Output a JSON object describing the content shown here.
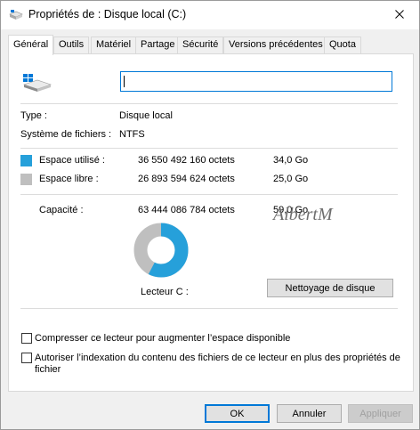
{
  "window": {
    "title": "Propriétés de : Disque local (C:)"
  },
  "tabs": [
    {
      "label": "Général"
    },
    {
      "label": "Outils"
    },
    {
      "label": "Matériel"
    },
    {
      "label": "Partage"
    },
    {
      "label": "Sécurité"
    },
    {
      "label": "Versions précédentes"
    },
    {
      "label": "Quota"
    }
  ],
  "volume_name": {
    "value": ""
  },
  "info": {
    "type_label": "Type :",
    "type_value": "Disque local",
    "fs_label": "Système de fichiers :",
    "fs_value": "NTFS"
  },
  "space": {
    "used_label": "Espace utilisé :",
    "used_bytes": "36 550 492 160 octets",
    "used_size": "34,0 Go",
    "used_fraction": 0.576,
    "free_label": "Espace libre :",
    "free_bytes": "26 893 594 624 octets",
    "free_size": "25,0 Go",
    "capacity_label": "Capacité :",
    "capacity_bytes": "63 444 086 784 octets",
    "capacity_size": "59,0 Go",
    "drive_label": "Lecteur C :",
    "used_color": "#26a0da",
    "free_color": "#bfbfbf"
  },
  "watermark": "AlbertM",
  "cleanup_button": "Nettoyage de disque",
  "options": {
    "compress_label": "Compresser ce lecteur pour augmenter l’espace disponible",
    "index_label_line1": "Autoriser l’indexation du contenu des fichiers de ce lecteur en plus des propriétés de",
    "index_label_line2": "fichier"
  },
  "buttons": {
    "ok": "OK",
    "cancel": "Annuler",
    "apply": "Appliquer"
  }
}
